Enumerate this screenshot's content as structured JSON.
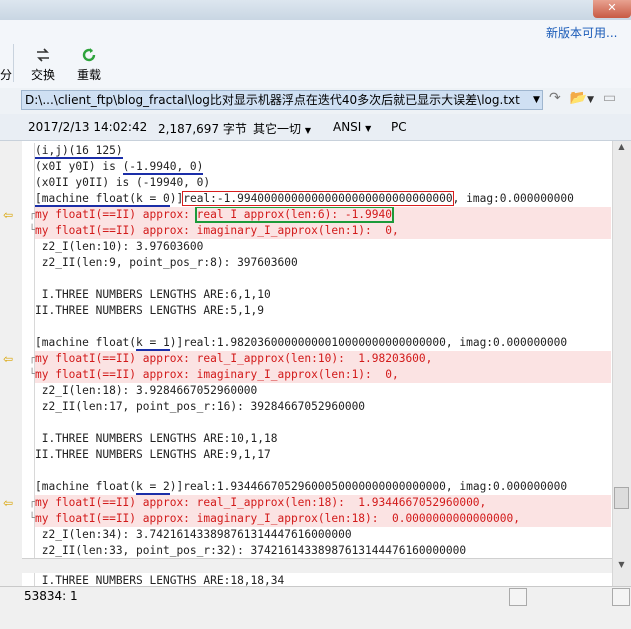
{
  "window": {
    "close_glyph": "✕"
  },
  "ribbon": {
    "update_link": "新版本可用...",
    "edge_label": "分",
    "swap_label": "交换",
    "reload_label": "重载"
  },
  "address": {
    "path": "D:\\...\\client_ftp\\blog_fractal\\log比对显示机器浮点在迭代40多次后就已显示大误差\\log.txt"
  },
  "info": {
    "datetime": "2017/2/13 14:02:42",
    "size": "2,187,697 字节",
    "filter": "其它一切",
    "encoding": "ANSI",
    "line_ending": "PC"
  },
  "editor": {
    "l1": "(i,j)(16 125)",
    "l2a": "(x0I y0I) is ",
    "l2b": "(-1.9940, 0)",
    "l3": "(x0II y0II) is (-19940, 0)",
    "l4a": "[machine float(",
    "l4b": "k = 0",
    "l4c": ")]",
    "l4d": "real:-1.99400000000000000000000000000000",
    "l4e": ", imag:0.000000000",
    "l5a": "my floatI(==II) approx: ",
    "l5b": "real I approx(len:6): -1.9940",
    "l6": "my floatI(==II) approx: imaginary_I_approx(len:1):  0,",
    "l7": " z2_I(len:10): 3.97603600",
    "l8": " z2_II(len:9, point_pos_r:8): 397603600",
    "l9": " I.THREE NUMBERS LENGTHS ARE:6,1,10",
    "l10": "II.THREE NUMBERS LENGTHS ARE:5,1,9",
    "l11a": "[machine float(",
    "l11b": "k = 1",
    "l11c": ")]real:1.98203600000000010000000000000000, imag:0.000000000",
    "l12": "my floatI(==II) approx: real_I_approx(len:10):  1.98203600,",
    "l13": "my floatI(==II) approx: imaginary_I_approx(len:1):  0,",
    "l14": " z2_I(len:18): 3.9284667052960000",
    "l15": " z2_II(len:17, point_pos_r:16): 39284667052960000",
    "l16": " I.THREE NUMBERS LENGTHS ARE:10,1,18",
    "l17": "II.THREE NUMBERS LENGTHS ARE:9,1,17",
    "l18a": "[machine float(",
    "l18b": "k = 2",
    "l18c": ")]real:1.93446670529600050000000000000000, imag:0.000000000",
    "l19": "my floatI(==II) approx: real_I_approx(len:18):  1.9344667052960000,",
    "l20": "my floatI(==II) approx: imaginary_I_approx(len:18):  0.0000000000000000,",
    "l21": " z2_I(len:34): 3.742161433898761314447616000000",
    "l22": " z2_II(len:33, point_pos_r:32): 37421614338987613144476160000000",
    "l23": " I.THREE NUMBERS LENGTHS ARE:18,18,34"
  },
  "status": {
    "position": "53834: 1"
  }
}
